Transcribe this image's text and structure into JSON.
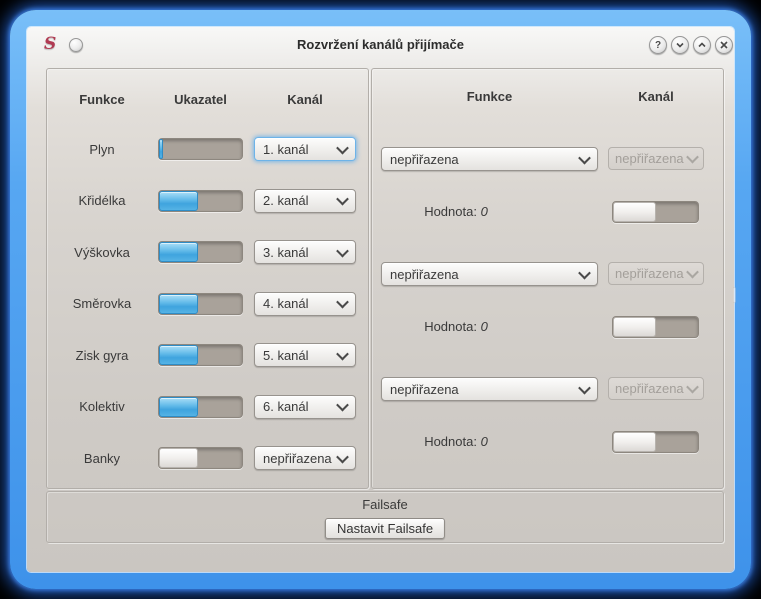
{
  "titlebar": {
    "app_icon_glyph": "S",
    "title": "Rozvržení kanálů přijímače",
    "buttons": {
      "help": "?",
      "minimize_icon": "chevron-down",
      "maximize_icon": "chevron-up",
      "close_icon": "cross"
    }
  },
  "left_panel": {
    "headers": [
      "Funkce",
      "Ukazatel",
      "Kanál"
    ],
    "rows": [
      {
        "label": "Plyn",
        "indicator_pct": 5,
        "indicator_color": "blue",
        "channel": "1. kanál",
        "focused": true
      },
      {
        "label": "Křidélka",
        "indicator_pct": 47,
        "indicator_color": "blue",
        "channel": "2. kanál",
        "focused": false
      },
      {
        "label": "Výškovka",
        "indicator_pct": 47,
        "indicator_color": "blue",
        "channel": "3. kanál",
        "focused": false
      },
      {
        "label": "Směrovka",
        "indicator_pct": 47,
        "indicator_color": "blue",
        "channel": "4. kanál",
        "focused": false
      },
      {
        "label": "Zisk gyra",
        "indicator_pct": 47,
        "indicator_color": "blue",
        "channel": "5. kanál",
        "focused": false
      },
      {
        "label": "Kolektiv",
        "indicator_pct": 47,
        "indicator_color": "blue",
        "channel": "6. kanál",
        "focused": false
      },
      {
        "label": "Banky",
        "indicator_pct": 47,
        "indicator_color": "white",
        "channel": "nepřiřazena",
        "focused": false
      }
    ]
  },
  "right_panel": {
    "headers": [
      "Funkce",
      "Kanál"
    ],
    "groups": [
      {
        "function": "nepřiřazena",
        "channel": "nepřiřazena",
        "channel_disabled": true,
        "value_label": "Hodnota:",
        "value": "0",
        "indicator_pct": 50,
        "indicator_color": "white"
      },
      {
        "function": "nepřiřazena",
        "channel": "nepřiřazena",
        "channel_disabled": true,
        "value_label": "Hodnota:",
        "value": "0",
        "indicator_pct": 50,
        "indicator_color": "white"
      },
      {
        "function": "nepřiřazena",
        "channel": "nepřiřazena",
        "channel_disabled": true,
        "value_label": "Hodnota:",
        "value": "0",
        "indicator_pct": 50,
        "indicator_color": "white"
      }
    ]
  },
  "failsafe": {
    "label": "Failsafe",
    "button_label": "Nastavit Failsafe"
  },
  "colors": {
    "glow_blue": "#4a9df0",
    "progress_blue": "#4fb0e5",
    "app_icon_red": "#b03a52",
    "focus_ring_blue": "#6db3e8"
  }
}
